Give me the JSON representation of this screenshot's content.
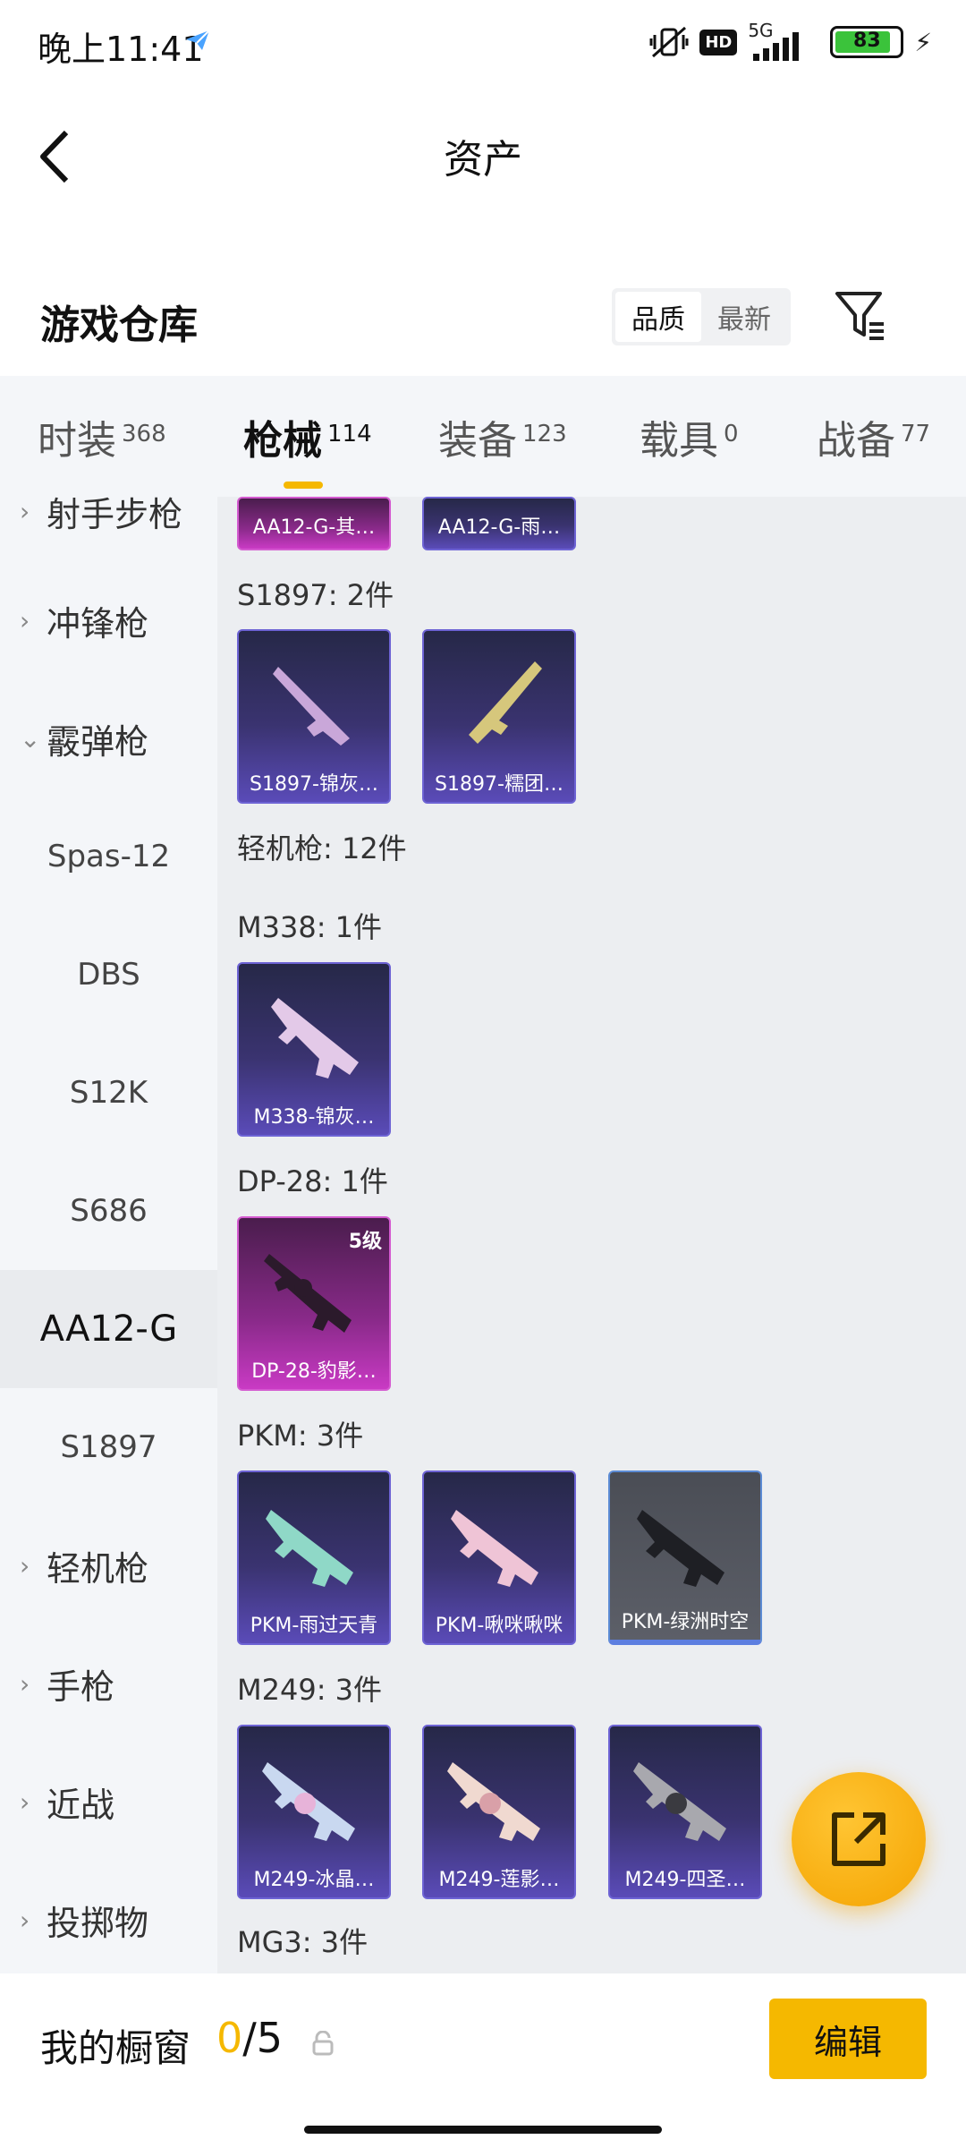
{
  "status_bar": {
    "time": "晚上11:41",
    "hd": "HD",
    "network": "5G",
    "battery": "83"
  },
  "header": {
    "title": "资产"
  },
  "section": {
    "title": "游戏仓库",
    "sort_options": [
      "品质",
      "最新"
    ],
    "sort_selected": "品质"
  },
  "category_tabs": [
    {
      "label": "时装",
      "count": "368",
      "active": false
    },
    {
      "label": "枪械",
      "count": "114",
      "active": true
    },
    {
      "label": "装备",
      "count": "123",
      "active": false
    },
    {
      "label": "载具",
      "count": "0",
      "active": false
    },
    {
      "label": "战备",
      "count": "77",
      "active": false
    }
  ],
  "sidebar": {
    "items": [
      {
        "label": "射手步枪",
        "type": "parent",
        "expanded": false
      },
      {
        "label": "冲锋枪",
        "type": "parent",
        "expanded": false
      },
      {
        "label": "霰弹枪",
        "type": "parent",
        "expanded": true
      },
      {
        "label": "Spas-12",
        "type": "child"
      },
      {
        "label": "DBS",
        "type": "child"
      },
      {
        "label": "S12K",
        "type": "child"
      },
      {
        "label": "S686",
        "type": "child"
      },
      {
        "label": "AA12-G",
        "type": "child",
        "selected": true
      },
      {
        "label": "S1897",
        "type": "child"
      },
      {
        "label": "轻机枪",
        "type": "parent",
        "expanded": false
      },
      {
        "label": "手枪",
        "type": "parent",
        "expanded": false
      },
      {
        "label": "近战",
        "type": "parent",
        "expanded": false
      },
      {
        "label": "投掷物",
        "type": "parent",
        "expanded": false
      }
    ]
  },
  "content": {
    "top_cards": [
      {
        "name": "AA12-G-其…",
        "rarity": "pink"
      },
      {
        "name": "AA12-G-雨…",
        "rarity": "purple"
      }
    ],
    "groups": [
      {
        "label": "S1897: 2件",
        "cards": [
          {
            "name": "S1897-锦灰…",
            "rarity": "purple"
          },
          {
            "name": "S1897-糯团…",
            "rarity": "purple"
          }
        ]
      },
      {
        "label": "轻机枪: 12件",
        "cards": []
      },
      {
        "label": "M338: 1件",
        "cards": [
          {
            "name": "M338-锦灰…",
            "rarity": "purple"
          }
        ]
      },
      {
        "label": "DP-28: 1件",
        "cards": [
          {
            "name": "DP-28-豹影…",
            "rarity": "pink",
            "level": "5级"
          }
        ]
      },
      {
        "label": "PKM: 3件",
        "cards": [
          {
            "name": "PKM-雨过天青",
            "rarity": "purple"
          },
          {
            "name": "PKM-啾咪啾咪",
            "rarity": "purple"
          },
          {
            "name": "PKM-绿洲时空",
            "rarity": "gray"
          }
        ]
      },
      {
        "label": "M249: 3件",
        "cards": [
          {
            "name": "M249-冰晶…",
            "rarity": "purple"
          },
          {
            "name": "M249-莲影…",
            "rarity": "purple"
          },
          {
            "name": "M249-四圣…",
            "rarity": "purple"
          }
        ]
      },
      {
        "label": "MG3: 3件",
        "cards": []
      }
    ]
  },
  "bottom_bar": {
    "label": "我的橱窗",
    "current": "0",
    "separator": "/",
    "max": "5",
    "edit_label": "编辑"
  },
  "colors": {
    "accent": "#f5b800",
    "purple_card": "#5a4bb8",
    "pink_card": "#c93ac4"
  }
}
